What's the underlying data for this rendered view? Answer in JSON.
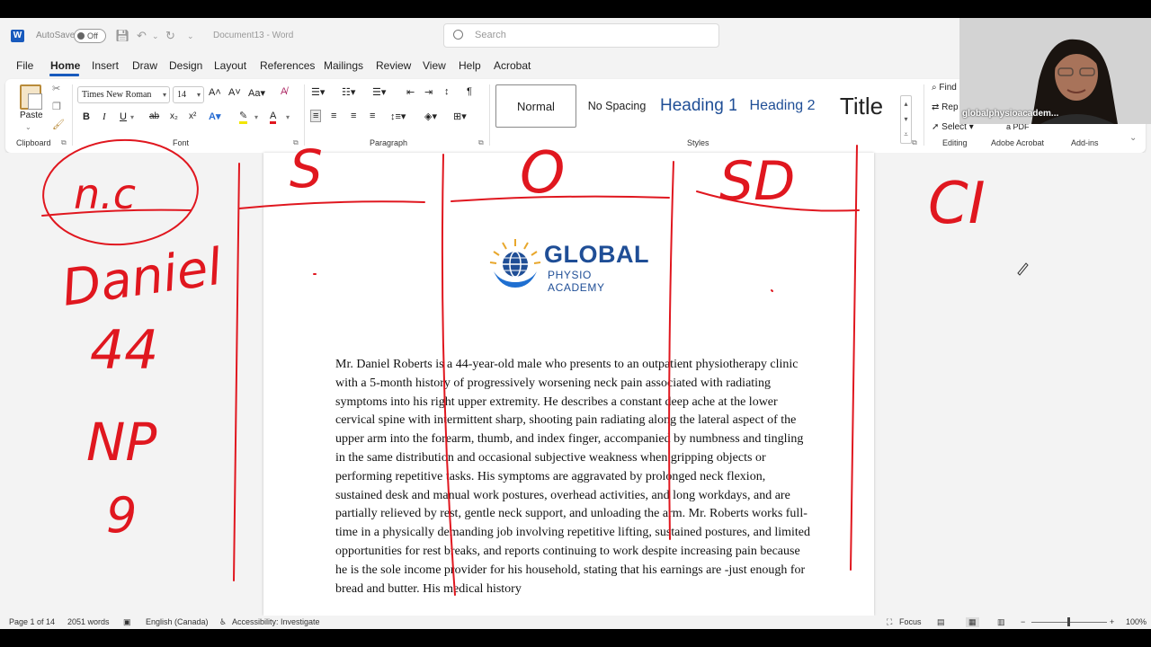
{
  "titlebar": {
    "app_icon": "word-logo-icon",
    "autosave_label": "AutoSave",
    "autosave_state": "Off",
    "document_title": "Document13 - Word",
    "search_placeholder": "Search"
  },
  "tabs": [
    {
      "label": "File"
    },
    {
      "label": "Home",
      "active": true
    },
    {
      "label": "Insert"
    },
    {
      "label": "Draw"
    },
    {
      "label": "Design"
    },
    {
      "label": "Layout"
    },
    {
      "label": "References"
    },
    {
      "label": "Mailings"
    },
    {
      "label": "Review"
    },
    {
      "label": "View"
    },
    {
      "label": "Help"
    },
    {
      "label": "Acrobat"
    }
  ],
  "ribbon": {
    "clipboard": {
      "paste_label": "Paste",
      "group_label": "Clipboard"
    },
    "font": {
      "family": "Times New Roman",
      "size": "14",
      "group_label": "Font",
      "bold": "B",
      "italic": "I",
      "underline": "U",
      "strike": "ab",
      "subscript": "x₂",
      "superscript": "x²"
    },
    "paragraph": {
      "group_label": "Paragraph"
    },
    "styles": {
      "group_label": "Styles",
      "items": [
        {
          "label": "Normal",
          "selected": true
        },
        {
          "label": "No Spacing"
        },
        {
          "label": "Heading 1"
        },
        {
          "label": "Heading 2"
        },
        {
          "label": "Title"
        }
      ]
    },
    "editing": {
      "find": "Find",
      "replace": "Rep",
      "select": "Select",
      "group_label": "Editing"
    },
    "adobe": {
      "label": "Adobe Acrobat",
      "pdf": "a PDF"
    },
    "addins": {
      "label": "Add-ins"
    }
  },
  "document": {
    "logo_main": "GLOBAL",
    "logo_sub": "PHYSIO ACADEMY",
    "paragraph": "Mr. Daniel Roberts is a 44-year-old male who presents to an outpatient physiotherapy clinic with a 5-month history of progressively worsening neck pain associated with radiating symptoms into his right upper extremity. He describes a constant deep ache at the lower cervical spine with intermittent sharp, shooting pain radiating along the lateral aspect of the upper arm into the forearm, thumb, and index finger, accompanied by numbness and tingling in the same distribution and occasional subjective weakness when gripping objects or performing repetitive tasks. His symptoms are aggravated by prolonged neck flexion, sustained desk and manual work postures, overhead activities, and long workdays, and are partially relieved by rest, gentle neck support, and unloading the arm. Mr. Roberts works full-time in a physically demanding job involving repetitive lifting, sustained postures, and limited opportunities for rest breaks, and reports continuing to work despite increasing pain because he is the sole income provider for his household, stating that his earnings are -just enough for bread and butter. His medical history"
  },
  "statusbar": {
    "page": "Page 1 of 14",
    "words": "2051 words",
    "language": "English (Canada)",
    "accessibility": "Accessibility: Investigate",
    "focus": "Focus",
    "zoom": "100%"
  },
  "webcam": {
    "name": "globalphysioacadem..."
  },
  "annotations": {
    "top_left": "n.c",
    "name": "Daniel",
    "age": "44",
    "complaint": "NP",
    "duration": "9",
    "col1": "S",
    "col2": "O",
    "col3": "SD",
    "right": "CI"
  },
  "colors": {
    "accent": "#185abd",
    "ink": "#e0171f",
    "logo": "#1f4e96"
  }
}
